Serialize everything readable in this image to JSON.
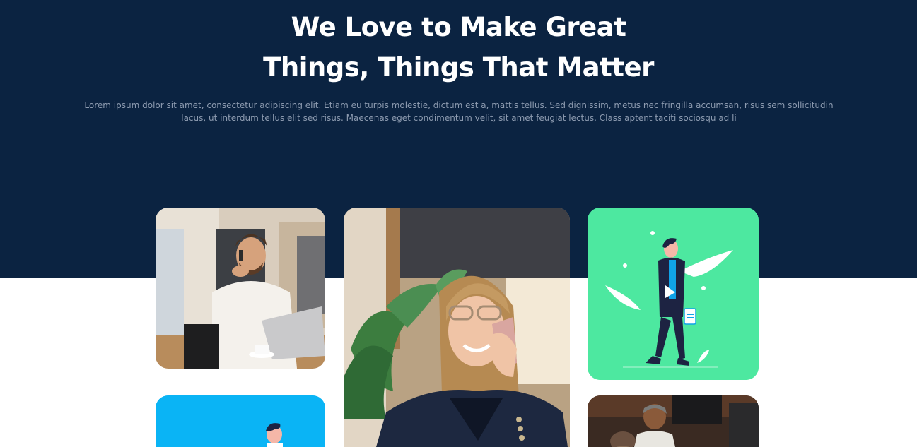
{
  "hero": {
    "title_line1": "We Love to Make Great",
    "title_line2": "Things, Things That Matter",
    "description": "Lorem ipsum dolor sit amet, consectetur adipiscing elit. Etiam eu turpis molestie, dictum est a, mattis tellus. Sed dignissim, metus nec fringilla accumsan, risus sem sollicitudin lacus, ut interdum tellus elit sed risus. Maecenas eget condimentum velit, sit amet feugiat lectus. Class aptent taciti sociosqu ad li"
  },
  "colors": {
    "hero_background": "#0b2341",
    "title": "#ffffff",
    "description": "#8d9bb0",
    "green_card": "#4de8a0",
    "blue_card": "#0ab4f5"
  },
  "gallery": {
    "cards": [
      {
        "kind": "photo",
        "subject": "man-on-phone-with-laptop"
      },
      {
        "kind": "photo",
        "subject": "woman-on-phone-with-glasses"
      },
      {
        "kind": "illustration",
        "subject": "walking-man-illustration"
      },
      {
        "kind": "illustration",
        "subject": "person-illustration"
      },
      {
        "kind": "photo",
        "subject": "man-with-cap-in-office"
      }
    ]
  }
}
